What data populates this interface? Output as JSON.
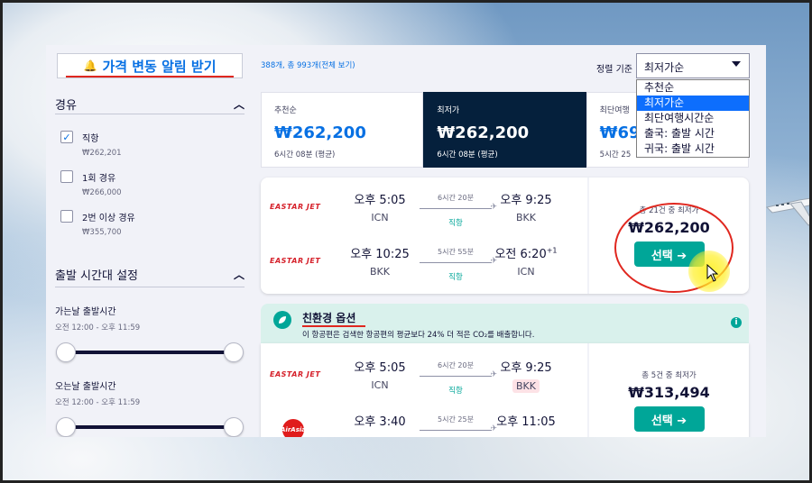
{
  "sidebar": {
    "alert_button": "가격 변동 알림 받기",
    "section_stops": "경유",
    "stops": [
      {
        "label": "직항",
        "price": "₩262,201",
        "checked": true
      },
      {
        "label": "1회 경유",
        "price": "₩266,000",
        "checked": false
      },
      {
        "label": "2번 이상 경유",
        "price": "₩355,700",
        "checked": false
      }
    ],
    "section_time": "출발 시간대 설정",
    "outbound": {
      "label": "가는날 출발시간",
      "range": "오전 12:00 - 오후 11:59"
    },
    "inbound": {
      "label": "오는날 출발시간",
      "range": "오전 12:00 - 오후 11:59"
    }
  },
  "results_count": "388개, 총 993개(전체 보기)",
  "sort": {
    "label": "정렬 기준",
    "selected": "최저가순",
    "options": [
      "추천순",
      "최저가순",
      "최단여행시간순",
      "출국: 출발 시간",
      "귀국: 출발 시간"
    ],
    "selected_index": 1
  },
  "tabs": [
    {
      "title": "추천순",
      "price": "₩262,200",
      "duration": "6시간 08분 (평균)"
    },
    {
      "title": "최저가",
      "price": "₩262,200",
      "duration": "6시간 08분 (평균)"
    },
    {
      "title": "최단여행",
      "price": "₩69",
      "duration": "5시간 25"
    }
  ],
  "card1": {
    "legs": [
      {
        "airline": "EASTAR JET",
        "dep_time": "오후 5:05",
        "dep_apt": "ICN",
        "duration": "6시간 20분",
        "stops": "직항",
        "arr_time": "오후 9:25",
        "arr_apt": "BKK",
        "plus": ""
      },
      {
        "airline": "EASTAR JET",
        "dep_time": "오후 10:25",
        "dep_apt": "BKK",
        "duration": "5시간 55분",
        "stops": "직항",
        "arr_time": "오전 6:20",
        "arr_apt": "ICN",
        "plus": "+1"
      }
    ],
    "from_text": "총 21건 중 최저가",
    "price": "₩262,200",
    "select": "선택 ➔"
  },
  "eco": {
    "title": "친환경 옵션",
    "description": "이 항공편은 검색한 항공편의 평균보다 24% 더 적은 CO₂를 배출합니다."
  },
  "card2": {
    "legs": [
      {
        "airline": "EASTAR JET",
        "dep_time": "오후 5:05",
        "dep_apt": "ICN",
        "duration": "6시간 20분",
        "stops": "직항",
        "arr_time": "오후 9:25",
        "arr_apt": "BKK"
      },
      {
        "airline": "AirAsia",
        "dep_time": "오후 3:40",
        "dep_apt": "",
        "duration": "5시간 25분",
        "stops": "",
        "arr_time": "오후 11:05",
        "arr_apt": ""
      }
    ],
    "from_text": "총 5건 중 최저가",
    "price": "₩313,494",
    "select": "선택 ➔"
  },
  "colors": {
    "accent": "#0770e3",
    "dark": "#05203c",
    "green": "#00a698",
    "annotation_red": "#e0271f"
  }
}
